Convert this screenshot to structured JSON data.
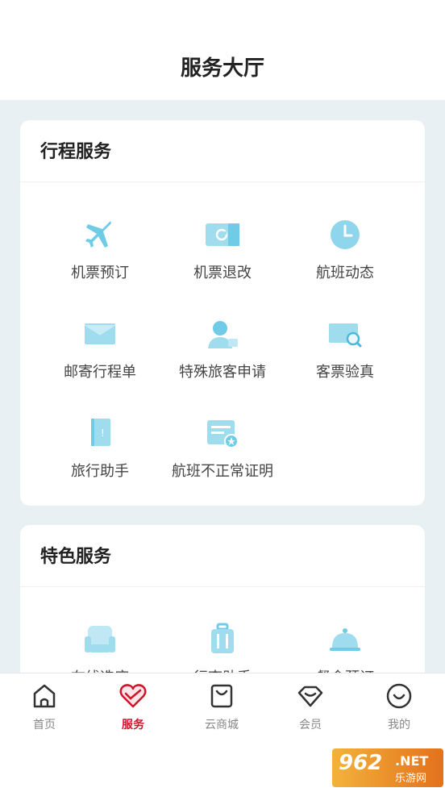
{
  "header": {
    "title": "服务大厅"
  },
  "travel_services": {
    "title": "行程服务",
    "items": [
      {
        "label": "机票预订",
        "icon": "airplane-icon"
      },
      {
        "label": "机票退改",
        "icon": "ticket-refund-icon"
      },
      {
        "label": "航班动态",
        "icon": "clock-icon"
      },
      {
        "label": "邮寄行程单",
        "icon": "envelope-icon"
      },
      {
        "label": "特殊旅客申请",
        "icon": "person-icon"
      },
      {
        "label": "客票验真",
        "icon": "ticket-search-icon"
      },
      {
        "label": "旅行助手",
        "icon": "guidebook-icon"
      },
      {
        "label": "航班不正常证明",
        "icon": "certificate-icon"
      }
    ]
  },
  "featured_services": {
    "title": "特色服务",
    "items": [
      {
        "label": "在线选座",
        "icon": "seat-icon"
      },
      {
        "label": "行李助手",
        "icon": "luggage-icon"
      },
      {
        "label": "餐食预订",
        "icon": "meal-cloche-icon"
      }
    ]
  },
  "tabbar": {
    "items": [
      {
        "label": "首页",
        "icon": "home-icon"
      },
      {
        "label": "服务",
        "icon": "heart-icon",
        "active": true
      },
      {
        "label": "云商城",
        "icon": "shopping-bag-icon"
      },
      {
        "label": "会员",
        "icon": "member-diamond-icon"
      },
      {
        "label": "我的",
        "icon": "smiley-icon"
      }
    ]
  },
  "watermark": {
    "number": "962",
    "net": ".NET",
    "cn": "乐游网"
  },
  "colors": {
    "accent": "#d0142a",
    "icon_blue": "#7fd3ea",
    "background": "#e8f0f3"
  }
}
